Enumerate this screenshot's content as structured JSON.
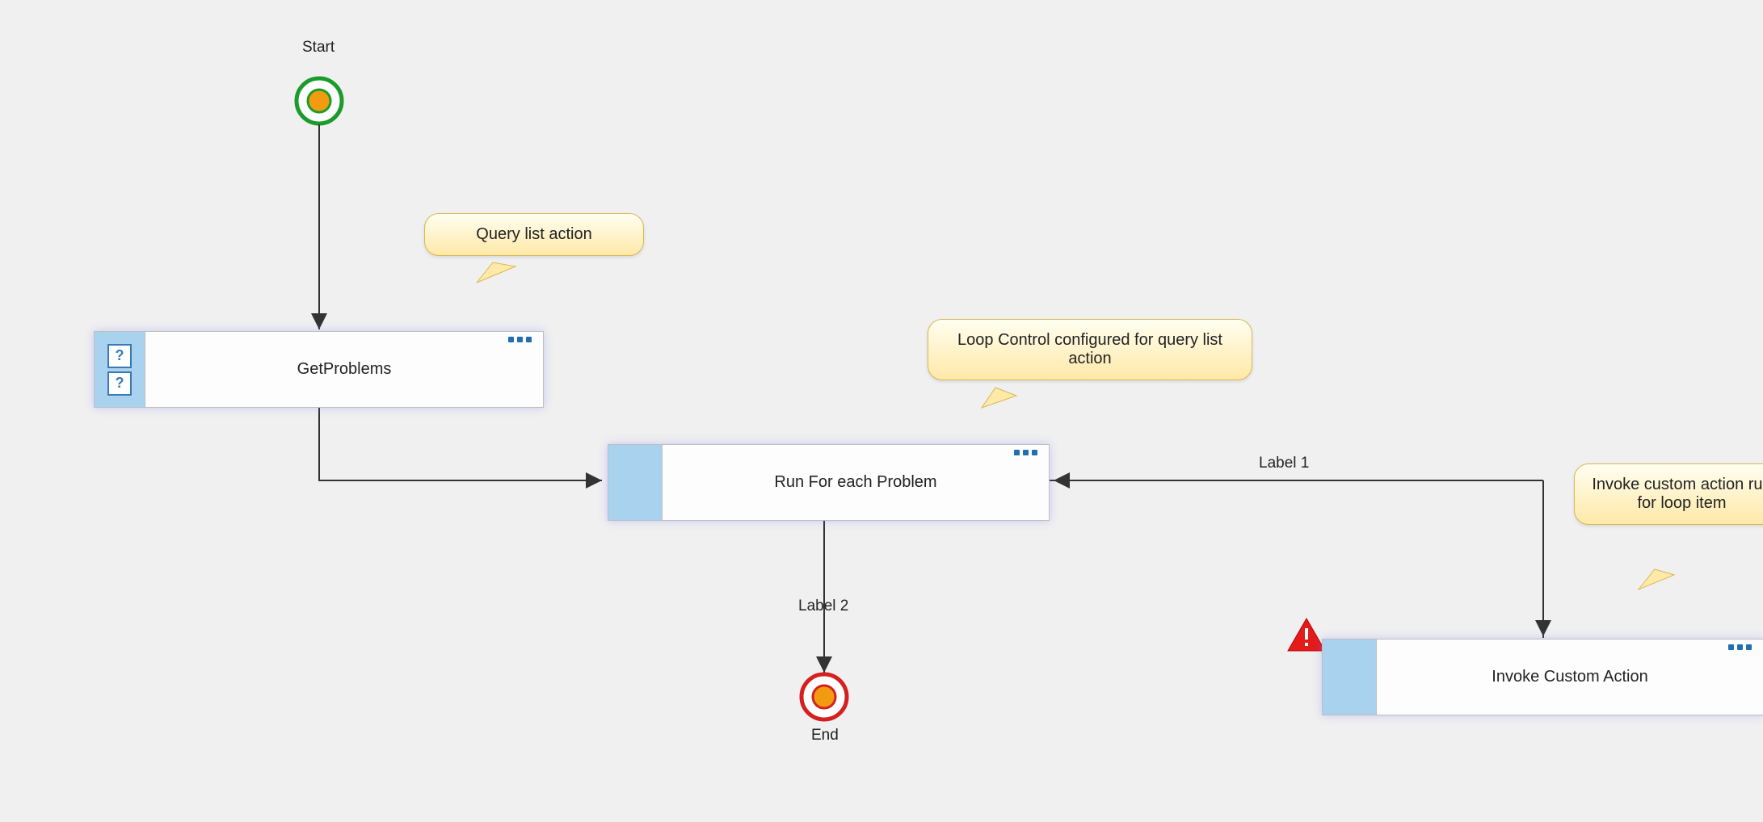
{
  "start": {
    "label": "Start"
  },
  "end": {
    "label": "End"
  },
  "nodes": {
    "getProblems": {
      "label": "GetProblems"
    },
    "runForEach": {
      "label": "Run For each Problem"
    },
    "invokeCustom": {
      "label": "Invoke Custom Action"
    }
  },
  "callouts": {
    "queryList": "Query list action",
    "loopControl": "Loop Control configured for query list action",
    "invokeCustom": "Invoke custom action run for loop item"
  },
  "edges": {
    "label1": "Label 1",
    "label2": "Label 2"
  },
  "icons": {
    "question": "?",
    "warning": "!"
  }
}
